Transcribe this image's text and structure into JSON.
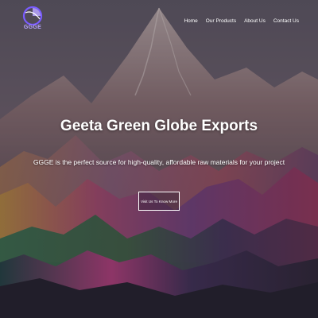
{
  "header": {
    "logo_text": "GGGE",
    "nav": [
      {
        "label": "Home"
      },
      {
        "label": "Our Products"
      },
      {
        "label": "About Us"
      },
      {
        "label": "Contact Us"
      }
    ]
  },
  "hero": {
    "title": "Geeta Green Globe Exports",
    "subtitle": "GGGE is the perfect source for high-quality, affordable raw materials for your project",
    "cta_label": "Visit Us To Know More",
    "background_image": "mountain-landscape"
  },
  "colors": {
    "accent": "#7a5cff",
    "overlay": "#3e3a44",
    "text": "#ffffff"
  }
}
